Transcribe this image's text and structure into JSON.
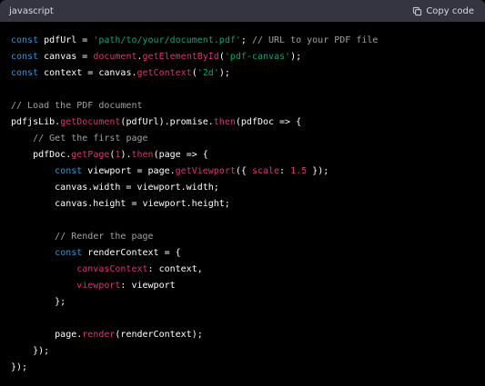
{
  "header": {
    "language": "javascript",
    "copy_label": "Copy code",
    "copy_icon": "clipboard-icon"
  },
  "colors": {
    "header_bg": "#343541",
    "code_bg": "#000000",
    "keyword": "#2e95d3",
    "string": "#00a67d",
    "function": "#df3079",
    "comment": "#a0a0a0",
    "plain": "#ffffff"
  },
  "code": {
    "lines": [
      [
        [
          "kw",
          "const"
        ],
        [
          "plain",
          " pdfUrl = "
        ],
        [
          "str",
          "'path/to/your/document.pdf'"
        ],
        [
          "plain",
          "; "
        ],
        [
          "cm",
          "// URL to your PDF file"
        ]
      ],
      [
        [
          "kw",
          "const"
        ],
        [
          "plain",
          " canvas = "
        ],
        [
          "fn",
          "document"
        ],
        [
          "plain",
          "."
        ],
        [
          "fn",
          "getElementById"
        ],
        [
          "plain",
          "("
        ],
        [
          "str",
          "'pdf-canvas'"
        ],
        [
          "plain",
          ");"
        ]
      ],
      [
        [
          "kw",
          "const"
        ],
        [
          "plain",
          " context = canvas."
        ],
        [
          "fn",
          "getContext"
        ],
        [
          "plain",
          "("
        ],
        [
          "str",
          "'2d'"
        ],
        [
          "plain",
          ");"
        ]
      ],
      [],
      [
        [
          "cm",
          "// Load the PDF document"
        ]
      ],
      [
        [
          "plain",
          "pdfjsLib."
        ],
        [
          "fn",
          "getDocument"
        ],
        [
          "plain",
          "(pdfUrl).promise."
        ],
        [
          "fn",
          "then"
        ],
        [
          "plain",
          "(pdfDoc => {"
        ]
      ],
      [
        [
          "plain",
          "    "
        ],
        [
          "cm",
          "// Get the first page"
        ]
      ],
      [
        [
          "plain",
          "    pdfDoc."
        ],
        [
          "fn",
          "getPage"
        ],
        [
          "plain",
          "("
        ],
        [
          "num",
          "1"
        ],
        [
          "plain",
          ")."
        ],
        [
          "fn",
          "then"
        ],
        [
          "plain",
          "(page => {"
        ]
      ],
      [
        [
          "plain",
          "        "
        ],
        [
          "kw",
          "const"
        ],
        [
          "plain",
          " viewport = page."
        ],
        [
          "fn",
          "getViewport"
        ],
        [
          "plain",
          "({ "
        ],
        [
          "prop",
          "scale"
        ],
        [
          "plain",
          ": "
        ],
        [
          "num",
          "1.5"
        ],
        [
          "plain",
          " });"
        ]
      ],
      [
        [
          "plain",
          "        canvas.width = viewport.width;"
        ]
      ],
      [
        [
          "plain",
          "        canvas.height = viewport.height;"
        ]
      ],
      [],
      [
        [
          "plain",
          "        "
        ],
        [
          "cm",
          "// Render the page"
        ]
      ],
      [
        [
          "plain",
          "        "
        ],
        [
          "kw",
          "const"
        ],
        [
          "plain",
          " renderContext = {"
        ]
      ],
      [
        [
          "plain",
          "            "
        ],
        [
          "prop",
          "canvasContext"
        ],
        [
          "plain",
          ": context,"
        ]
      ],
      [
        [
          "plain",
          "            "
        ],
        [
          "prop",
          "viewport"
        ],
        [
          "plain",
          ": viewport"
        ]
      ],
      [
        [
          "plain",
          "        };"
        ]
      ],
      [],
      [
        [
          "plain",
          "        page."
        ],
        [
          "fn",
          "render"
        ],
        [
          "plain",
          "(renderContext);"
        ]
      ],
      [
        [
          "plain",
          "    });"
        ]
      ],
      [
        [
          "plain",
          "});"
        ]
      ]
    ]
  }
}
